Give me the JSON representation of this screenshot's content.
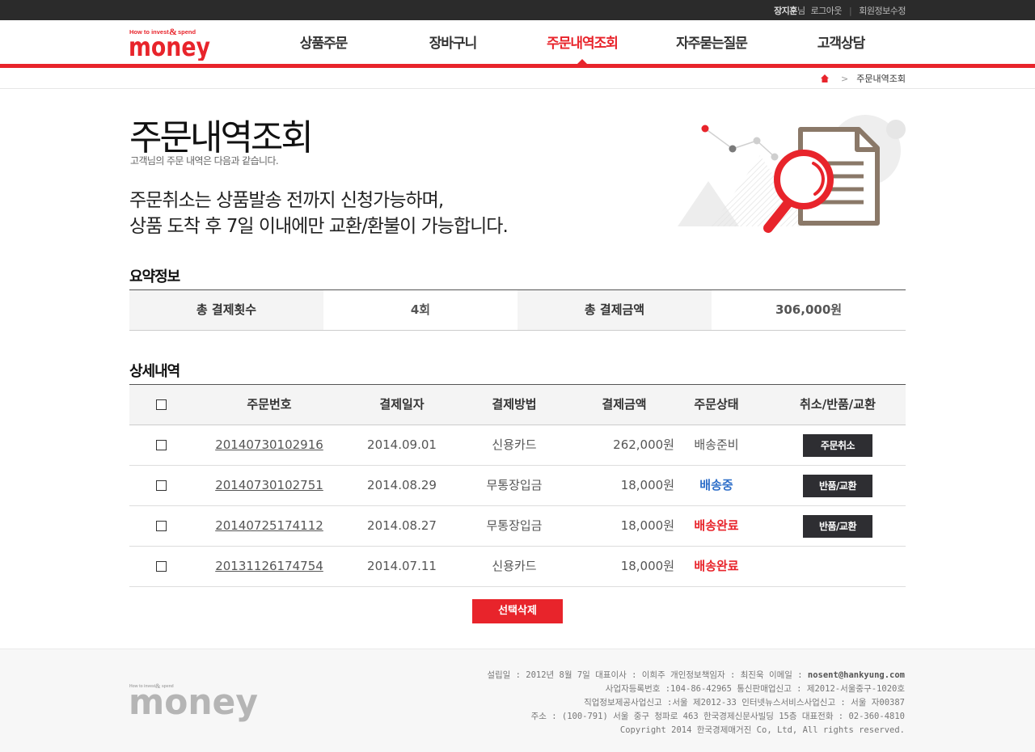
{
  "topbar": {
    "user_name": "장지훈",
    "user_suffix": "님",
    "logout": "로그아웃",
    "edit_profile": "회원정보수정"
  },
  "brand": {
    "logo_small": "How to invest & spend",
    "logo_word": "money",
    "accent_color": "#e8242b"
  },
  "gnb": {
    "items": [
      {
        "label": "상품주문"
      },
      {
        "label": "장바구니"
      },
      {
        "label": "주문내역조회",
        "active": true
      },
      {
        "label": "자주묻는질문"
      },
      {
        "label": "고객상담"
      }
    ]
  },
  "breadcrumb": {
    "current": "주문내역조회"
  },
  "page": {
    "title": "주문내역조회",
    "subtitle": "고객님의 주문 내역은 다음과 같습니다.",
    "notice_line1": "주문취소는 상품발송 전까지 신청가능하며,",
    "notice_line2": "상품 도착 후 7일 이내에만 교환/환불이 가능합니다."
  },
  "summary": {
    "title": "요약정보",
    "count_label": "총 결제횟수",
    "count_value": "4회",
    "amount_label": "총 결제금액",
    "amount_value": "306,000원"
  },
  "detail": {
    "title": "상세내역",
    "headers": {
      "order_no": "주문번호",
      "date": "결제일자",
      "method": "결제방법",
      "amount": "결제금액",
      "status": "주문상태",
      "action": "취소/반품/교환"
    },
    "rows": [
      {
        "order_no": "20140730102916",
        "date": "2014.09.01",
        "method": "신용카드",
        "amount": "262,000원",
        "status": "배송준비",
        "status_color": "#555555",
        "action": "주문취소"
      },
      {
        "order_no": "20140730102751",
        "date": "2014.08.29",
        "method": "무통장입금",
        "amount": "18,000원",
        "status": "배송중",
        "status_color": "#2f6fc9",
        "action": "반품/교환"
      },
      {
        "order_no": "20140725174112",
        "date": "2014.08.27",
        "method": "무통장입금",
        "amount": "18,000원",
        "status": "배송완료",
        "status_color": "#e8242b",
        "action": "반품/교환"
      },
      {
        "order_no": "20131126174754",
        "date": "2014.07.11",
        "method": "신용카드",
        "amount": "18,000원",
        "status": "배송완료",
        "status_color": "#e8242b",
        "action": ""
      }
    ],
    "delete_button": "선택삭제"
  },
  "footer": {
    "line1": "설립일 : 2012년 8월 7일 대표이사 : 이희주 개인정보책임자 : 최진욱 이메일 : ",
    "email": "nosent@hankyung.com",
    "line2": "사업자등록번호 :104-86-42965 통신판매업신고 : 제2012-서울중구-1020호",
    "line3": "직업정보제공사업신고 :서울 제2012-33 인터넷뉴스서비스사업신고 : 서울 자00387",
    "line4": "주소 : (100-791) 서울 중구 청파로 463 한국경제신문사빌딩 15층 대표전화 : 02-360-4810",
    "line5": "Copyright 2014 한국경제매거진 Co, Ltd, All rights reserved."
  }
}
